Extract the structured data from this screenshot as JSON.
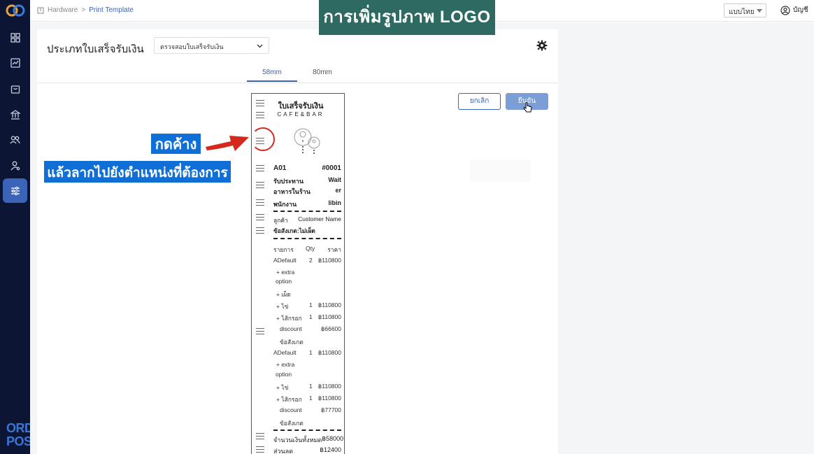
{
  "topbar": {
    "breadcrumb": [
      "Hardware",
      "Print Template"
    ],
    "breadcrumb_sep": ">",
    "language": "แบบไทย",
    "account": "บัญชี"
  },
  "page": {
    "title": "ประเภทใบเสร็จรับเงิน",
    "select_value": "ตรวจสอบใบเสร็จรับเงิน",
    "tabs": [
      "58mm",
      "80mm"
    ],
    "active_tab": "58mm",
    "cancel_label": "ยกเลิก",
    "confirm_label": "ยืนยัน"
  },
  "receipt": {
    "title": "ใบเสร็จรับเงิน",
    "subtitle": "CAFE&BAR",
    "table_label": "A01",
    "order_no": "#0001",
    "dining_label": "รับประทาน",
    "dining_value": "Wait",
    "dining_label2": "อาหารในร้าน",
    "dining_value2": "er",
    "staff_label": "พนักงาน",
    "staff_value": "libin",
    "customer_label": "ลูกค้า",
    "customer_value": "Customer Name",
    "note_line": "ข้อสังเกต:ไม่เผ็ด",
    "col_item": "รายการ",
    "col_qty": "Qty",
    "col_price": "ราคา",
    "rows": [
      {
        "name": "ADefault",
        "qty": "2",
        "price": "฿110800"
      },
      {
        "name": "+ extra",
        "qty": "",
        "price": ""
      },
      {
        "name": "option",
        "qty": "",
        "price": ""
      },
      {
        "name": "+ เผ็ด",
        "qty": "",
        "price": ""
      },
      {
        "name": "+ ไข่",
        "qty": "1",
        "price": "฿110800"
      },
      {
        "name": "+ ไส้กรอก",
        "qty": "1",
        "price": "฿110800"
      },
      {
        "name": "discount",
        "qty": "",
        "price": "฿66600"
      },
      {
        "name": "ข้อสังเกต",
        "qty": "",
        "price": ""
      },
      {
        "name": "ADefault",
        "qty": "1",
        "price": "฿110800"
      },
      {
        "name": "+ extra",
        "qty": "",
        "price": ""
      },
      {
        "name": "option",
        "qty": "",
        "price": ""
      },
      {
        "name": "+ ไข่",
        "qty": "1",
        "price": "฿110800"
      },
      {
        "name": "+ ไส้กรอก",
        "qty": "1",
        "price": "฿110800"
      },
      {
        "name": "discount",
        "qty": "",
        "price": "฿77700"
      },
      {
        "name": "ข้อสังเกต",
        "qty": "",
        "price": ""
      }
    ],
    "total_label": "จำนวนเงินทั้งหมด",
    "total_value": "฿58000",
    "discount_label": "ส่วนลด",
    "discount_value": "฿12400"
  },
  "annotations": {
    "banner": "การเพิ่มรูปภาพ LOGO",
    "press_hold": "กดค้าง",
    "drag_hint": "แล้วลากไปยังตำแหน่งที่ต้องการ"
  },
  "brand": {
    "line1": "ORDER",
    "line2": "POS"
  },
  "colors": {
    "accent": "#3b63b8",
    "sidebar": "#0d1535",
    "annotation_blue": "#0f6fd6",
    "banner": "#2e6a62",
    "marker_red": "#d42a1e"
  }
}
